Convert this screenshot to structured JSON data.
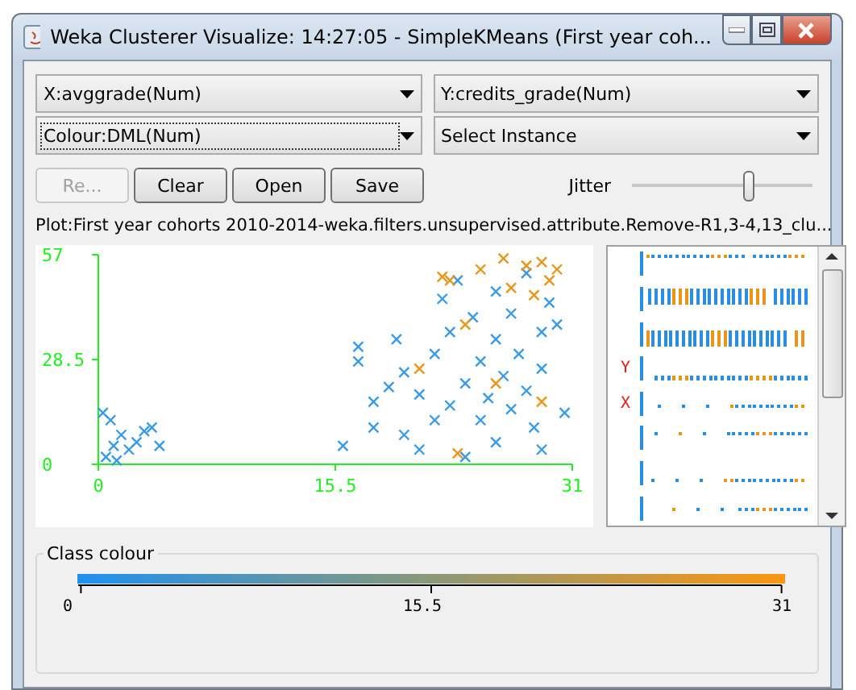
{
  "window": {
    "title": "Weka Clusterer Visualize: 14:27:05 - SimpleKMeans (First year coh..."
  },
  "selectors": [
    {
      "label": "X:avggrade(Num)",
      "focused": false
    },
    {
      "label": "Y:credits_grade(Num)",
      "focused": false
    },
    {
      "label": "Colour:DML(Num)",
      "focused": true
    },
    {
      "label": "Select Instance",
      "focused": false
    }
  ],
  "buttons": [
    {
      "label": "Re...",
      "disabled": true
    },
    {
      "label": "Clear",
      "disabled": false
    },
    {
      "label": "Open",
      "disabled": false
    },
    {
      "label": "Save",
      "disabled": false
    }
  ],
  "jitter": {
    "label": "Jitter",
    "level": 0.65
  },
  "plot": {
    "title": "Plot:First year cohorts 2010-2014-weka.filters.unsupervised.attribute.Remove-R1,3-4,13_clu...",
    "chart_data": {
      "type": "scatter",
      "xlim": [
        0,
        31
      ],
      "ylim": [
        0,
        57
      ],
      "xticks": [
        0,
        15.5,
        31
      ],
      "yticks": [
        0,
        28.5,
        57
      ],
      "series": [
        {
          "color": "#3a9ae6",
          "x": [
            0.5,
            1,
            1.5,
            0.8,
            2,
            2.5,
            3,
            3.5,
            1.2,
            4,
            0.3,
            16,
            17,
            17,
            18,
            18,
            19,
            19.5,
            20,
            20,
            21,
            21,
            22,
            22,
            22.5,
            23,
            23,
            24,
            24,
            24.5,
            25,
            25,
            25.5,
            26,
            26,
            26.5,
            27,
            27,
            27.5,
            28,
            28,
            28.5,
            29,
            29,
            29.5,
            30,
            30.5,
            29,
            23.5,
            26
          ],
          "values": [
            2,
            5,
            8,
            12,
            4,
            6,
            9,
            10,
            1,
            5,
            14,
            5,
            32,
            28,
            17,
            10,
            21,
            34,
            25,
            8,
            19,
            4,
            30,
            12,
            45,
            16,
            36,
            22,
            2,
            40,
            28,
            12,
            18,
            34,
            6,
            24,
            41,
            15,
            30,
            20,
            52,
            10,
            36,
            26,
            44,
            38,
            14,
            4,
            50,
            47
          ]
        },
        {
          "color": "#e8961a",
          "x": [
            22.5,
            23,
            25,
            26.5,
            27,
            28,
            29,
            29.5,
            30,
            28.5,
            24,
            26,
            21,
            23.5,
            29
          ],
          "values": [
            51,
            50,
            53,
            56,
            48,
            54,
            55,
            50,
            53,
            46,
            38,
            22,
            26,
            3,
            17
          ]
        }
      ]
    },
    "matrix": {
      "rows": [
        {
          "kind": "plain"
        },
        {
          "kind": "plain"
        },
        {
          "kind": "plain"
        },
        {
          "kind": "marked",
          "label": "Y"
        },
        {
          "kind": "marked",
          "label": "X"
        },
        {
          "kind": "plain"
        },
        {
          "kind": "plain"
        },
        {
          "kind": "plain"
        }
      ]
    }
  },
  "class_colour": {
    "title": "Class colour",
    "ticks": [
      "0",
      "15.5",
      "31"
    ]
  }
}
